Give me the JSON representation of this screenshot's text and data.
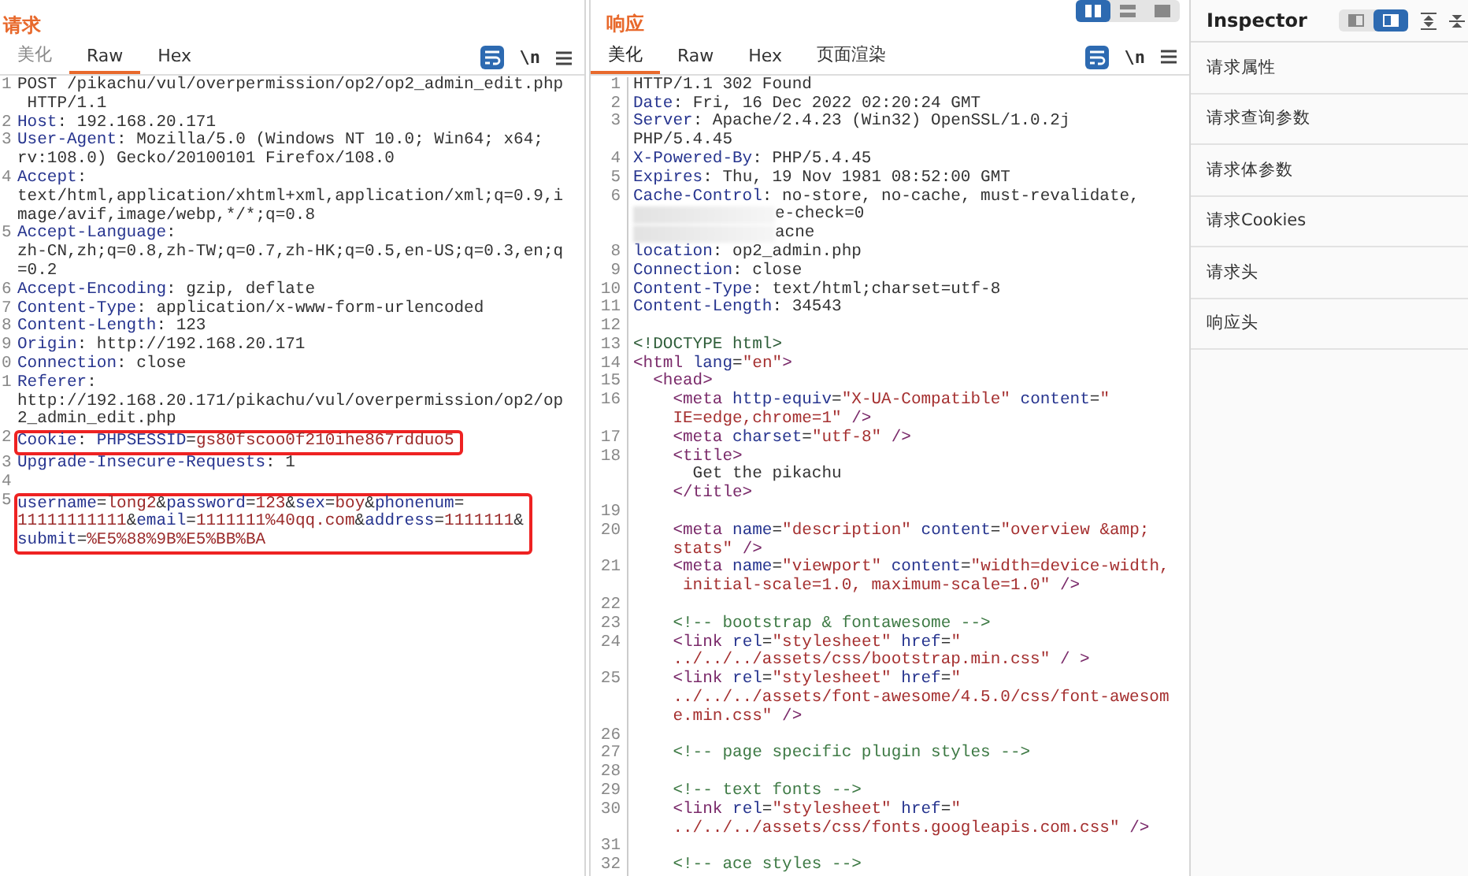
{
  "request": {
    "title": "请求",
    "tabs": [
      {
        "label": "美化",
        "selected": false
      },
      {
        "label": "Raw",
        "selected": true
      },
      {
        "label": "Hex",
        "selected": false
      }
    ],
    "newline_toggle": "\\n",
    "lines": [
      {
        "num": "1",
        "boxed": false,
        "rows": [
          {
            "parts": [
              {
                "kind": "plain",
                "text": "POST /pikachu/vul/overpermission/op2/op2_admin_edit.php"
              }
            ]
          },
          {
            "parts": [
              {
                "kind": "plain",
                "text": " HTTP/1.1"
              }
            ]
          }
        ]
      },
      {
        "num": "2",
        "boxed": false,
        "rows": [
          {
            "parts": [
              {
                "kind": "key",
                "text": "Host"
              },
              {
                "kind": "plain",
                "text": ": 192.168.20.171"
              }
            ]
          }
        ]
      },
      {
        "num": "3",
        "boxed": false,
        "rows": [
          {
            "parts": [
              {
                "kind": "key",
                "text": "User-Agent"
              },
              {
                "kind": "plain",
                "text": ": Mozilla/5.0 (Windows NT 10.0; Win64; x64;"
              }
            ]
          },
          {
            "parts": [
              {
                "kind": "plain",
                "text": "rv:108.0) Gecko/20100101 Firefox/108.0"
              }
            ]
          }
        ]
      },
      {
        "num": "4",
        "boxed": false,
        "rows": [
          {
            "parts": [
              {
                "kind": "key",
                "text": "Accept"
              },
              {
                "kind": "plain",
                "text": ":"
              }
            ]
          },
          {
            "parts": [
              {
                "kind": "plain",
                "text": "text/html,application/xhtml+xml,application/xml;q=0.9,i"
              }
            ]
          },
          {
            "parts": [
              {
                "kind": "plain",
                "text": "mage/avif,image/webp,*/*;q=0.8"
              }
            ]
          }
        ]
      },
      {
        "num": "5",
        "boxed": false,
        "rows": [
          {
            "parts": [
              {
                "kind": "key",
                "text": "Accept-Language"
              },
              {
                "kind": "plain",
                "text": ":"
              }
            ]
          },
          {
            "parts": [
              {
                "kind": "plain",
                "text": "zh-CN,zh;q=0.8,zh-TW;q=0.7,zh-HK;q=0.5,en-US;q=0.3,en;q"
              }
            ]
          },
          {
            "parts": [
              {
                "kind": "plain",
                "text": "=0.2"
              }
            ]
          }
        ]
      },
      {
        "num": "6",
        "boxed": false,
        "rows": [
          {
            "parts": [
              {
                "kind": "key",
                "text": "Accept-Encoding"
              },
              {
                "kind": "plain",
                "text": ": gzip, deflate"
              }
            ]
          }
        ]
      },
      {
        "num": "7",
        "boxed": false,
        "rows": [
          {
            "parts": [
              {
                "kind": "key",
                "text": "Content-Type"
              },
              {
                "kind": "plain",
                "text": ": application/x-www-form-urlencoded"
              }
            ]
          }
        ]
      },
      {
        "num": "8",
        "boxed": false,
        "rows": [
          {
            "parts": [
              {
                "kind": "key",
                "text": "Content-Length"
              },
              {
                "kind": "plain",
                "text": ": 123"
              }
            ]
          }
        ]
      },
      {
        "num": "9",
        "boxed": false,
        "rows": [
          {
            "parts": [
              {
                "kind": "key",
                "text": "Origin"
              },
              {
                "kind": "plain",
                "text": ": http://192.168.20.171"
              }
            ]
          }
        ]
      },
      {
        "num": "0",
        "boxed": false,
        "rows": [
          {
            "parts": [
              {
                "kind": "key",
                "text": "Connection"
              },
              {
                "kind": "plain",
                "text": ": close"
              }
            ]
          }
        ]
      },
      {
        "num": "1",
        "boxed": false,
        "rows": [
          {
            "parts": [
              {
                "kind": "key",
                "text": "Referer"
              },
              {
                "kind": "plain",
                "text": ":"
              }
            ]
          },
          {
            "parts": [
              {
                "kind": "plain",
                "text": "http://192.168.20.171/pikachu/vul/overpermission/op2/op"
              }
            ]
          },
          {
            "parts": [
              {
                "kind": "plain",
                "text": "2_admin_edit.php"
              }
            ]
          }
        ]
      },
      {
        "num": "2",
        "boxed": true,
        "rows": [
          {
            "parts": [
              {
                "kind": "key",
                "text": "Cookie"
              },
              {
                "kind": "plain",
                "text": ": "
              },
              {
                "kind": "pname",
                "text": "PHPSESSID"
              },
              {
                "kind": "plain",
                "text": "="
              },
              {
                "kind": "pval",
                "text": "gs80fscoo0f210ihe867rdduo5"
              }
            ]
          }
        ]
      },
      {
        "num": "3",
        "boxed": false,
        "rows": [
          {
            "parts": [
              {
                "kind": "key",
                "text": "Upgrade-Insecure-Requests"
              },
              {
                "kind": "plain",
                "text": ": 1"
              }
            ]
          }
        ]
      },
      {
        "num": "4",
        "boxed": false
      },
      {
        "num": "5",
        "boxed": true,
        "rows": [
          {
            "parts": [
              {
                "kind": "pname",
                "text": "username"
              },
              {
                "kind": "plain",
                "text": "="
              },
              {
                "kind": "pval",
                "text": "long2"
              },
              {
                "kind": "plain",
                "text": "&"
              },
              {
                "kind": "pname",
                "text": "password"
              },
              {
                "kind": "plain",
                "text": "="
              },
              {
                "kind": "pval",
                "text": "123"
              },
              {
                "kind": "plain",
                "text": "&"
              },
              {
                "kind": "pname",
                "text": "sex"
              },
              {
                "kind": "plain",
                "text": "="
              },
              {
                "kind": "pval",
                "text": "boy"
              },
              {
                "kind": "plain",
                "text": "&"
              },
              {
                "kind": "pname",
                "text": "phonenum"
              },
              {
                "kind": "plain",
                "text": "="
              }
            ]
          },
          {
            "parts": [
              {
                "kind": "pval",
                "text": "11111111111"
              },
              {
                "kind": "plain",
                "text": "&"
              },
              {
                "kind": "pname",
                "text": "email"
              },
              {
                "kind": "plain",
                "text": "="
              },
              {
                "kind": "pval",
                "text": "1111111%40qq.com"
              },
              {
                "kind": "plain",
                "text": "&"
              },
              {
                "kind": "pname",
                "text": "address"
              },
              {
                "kind": "plain",
                "text": "="
              },
              {
                "kind": "pval",
                "text": "1111111"
              },
              {
                "kind": "plain",
                "text": "&"
              }
            ]
          },
          {
            "parts": [
              {
                "kind": "pname",
                "text": "submit"
              },
              {
                "kind": "plain",
                "text": "="
              },
              {
                "kind": "pval",
                "text": "%E5%88%9B%E5%BB%BA"
              }
            ]
          }
        ]
      }
    ]
  },
  "response": {
    "title": "响应",
    "layout_buttons": [
      {
        "selected": true
      },
      {
        "selected": false
      },
      {
        "selected": false
      }
    ],
    "tabs": [
      {
        "label": "美化",
        "selected": true
      },
      {
        "label": "Raw",
        "selected": false
      },
      {
        "label": "Hex",
        "selected": false
      },
      {
        "label": "页面渲染",
        "selected": false
      }
    ],
    "newline_toggle": "\\n",
    "lines": [
      {
        "num": "1",
        "rows": [
          {
            "parts": [
              {
                "kind": "plain",
                "text": "HTTP/1.1 302 Found"
              }
            ]
          }
        ]
      },
      {
        "num": "2",
        "rows": [
          {
            "parts": [
              {
                "kind": "key",
                "text": "Date"
              },
              {
                "kind": "plain",
                "text": ": Fri, 16 Dec 2022 02:20:24 GMT"
              }
            ]
          }
        ]
      },
      {
        "num": "3",
        "rows": [
          {
            "parts": [
              {
                "kind": "key",
                "text": "Server"
              },
              {
                "kind": "plain",
                "text": ": Apache/2.4.23 (Win32) OpenSSL/1.0.2j"
              }
            ]
          },
          {
            "parts": [
              {
                "kind": "plain",
                "text": "PHP/5.4.45"
              }
            ]
          }
        ]
      },
      {
        "num": "4",
        "rows": [
          {
            "parts": [
              {
                "kind": "key",
                "text": "X-Powered-By"
              },
              {
                "kind": "plain",
                "text": ": PHP/5.4.45"
              }
            ]
          }
        ]
      },
      {
        "num": "5",
        "rows": [
          {
            "parts": [
              {
                "kind": "key",
                "text": "Expires"
              },
              {
                "kind": "plain",
                "text": ": Thu, 19 Nov 1981 08:52:00 GMT"
              }
            ]
          }
        ]
      },
      {
        "num": "6",
        "rows": [
          {
            "parts": [
              {
                "kind": "key",
                "text": "Cache-Control"
              },
              {
                "kind": "plain",
                "text": ": no-store, no-cache, must-revalidate,"
              }
            ]
          },
          {
            "parts": [
              {
                "kind": "smear"
              },
              {
                "kind": "plain",
                "text": "e-check=0"
              }
            ]
          }
        ]
      },
      {
        "rows": [
          {
            "parts": [
              {
                "kind": "smear"
              },
              {
                "kind": "plain",
                "text": "acne"
              }
            ]
          }
        ]
      },
      {
        "num": "8",
        "rows": [
          {
            "parts": [
              {
                "kind": "key",
                "text": "location"
              },
              {
                "kind": "plain",
                "text": ": op2_admin.php"
              }
            ]
          }
        ]
      },
      {
        "num": "9",
        "rows": [
          {
            "parts": [
              {
                "kind": "key",
                "text": "Connection"
              },
              {
                "kind": "plain",
                "text": ": close"
              }
            ]
          }
        ]
      },
      {
        "num": "10",
        "rows": [
          {
            "parts": [
              {
                "kind": "key",
                "text": "Content-Type"
              },
              {
                "kind": "plain",
                "text": ": text/html;charset=utf-8"
              }
            ]
          }
        ]
      },
      {
        "num": "11",
        "rows": [
          {
            "parts": [
              {
                "kind": "key",
                "text": "Content-Length"
              },
              {
                "kind": "plain",
                "text": ": 34543"
              }
            ]
          }
        ]
      },
      {
        "num": "12"
      },
      {
        "num": "13",
        "rows": [
          {
            "parts": [
              {
                "kind": "doctype",
                "text": "<!DOCTYPE html>"
              }
            ]
          }
        ]
      },
      {
        "num": "14",
        "rows": [
          {
            "parts": [
              {
                "kind": "tag",
                "text": "<html "
              },
              {
                "kind": "attr",
                "text": "lang"
              },
              {
                "kind": "plain",
                "text": "="
              },
              {
                "kind": "string",
                "text": "\"en\""
              },
              {
                "kind": "tag",
                "text": ">"
              }
            ]
          }
        ]
      },
      {
        "num": "15",
        "rows": [
          {
            "parts": [
              {
                "kind": "tag",
                "text": "  <head>"
              }
            ]
          }
        ]
      },
      {
        "num": "16",
        "rows": [
          {
            "parts": [
              {
                "kind": "tag",
                "text": "    <meta "
              },
              {
                "kind": "attr",
                "text": "http-equiv"
              },
              {
                "kind": "plain",
                "text": "="
              },
              {
                "kind": "string",
                "text": "\"X-UA-Compatible\" "
              },
              {
                "kind": "attr",
                "text": "content"
              },
              {
                "kind": "plain",
                "text": "="
              },
              {
                "kind": "string",
                "text": "\""
              }
            ]
          },
          {
            "parts": [
              {
                "kind": "string",
                "text": "    IE=edge,chrome=1\" "
              },
              {
                "kind": "tag",
                "text": "/>"
              }
            ]
          }
        ]
      },
      {
        "num": "17",
        "rows": [
          {
            "parts": [
              {
                "kind": "tag",
                "text": "    <meta "
              },
              {
                "kind": "attr",
                "text": "charset"
              },
              {
                "kind": "plain",
                "text": "="
              },
              {
                "kind": "string",
                "text": "\"utf-8\" "
              },
              {
                "kind": "tag",
                "text": "/>"
              }
            ]
          }
        ]
      },
      {
        "num": "18",
        "rows": [
          {
            "parts": [
              {
                "kind": "tag",
                "text": "    <title>"
              }
            ]
          },
          {
            "parts": [
              {
                "kind": "plain",
                "text": "      Get the pikachu"
              }
            ]
          },
          {
            "parts": [
              {
                "kind": "tag",
                "text": "    </title>"
              }
            ]
          }
        ]
      },
      {
        "num": "19"
      },
      {
        "num": "20",
        "rows": [
          {
            "parts": [
              {
                "kind": "tag",
                "text": "    <meta "
              },
              {
                "kind": "attr",
                "text": "name"
              },
              {
                "kind": "plain",
                "text": "="
              },
              {
                "kind": "string",
                "text": "\"description\" "
              },
              {
                "kind": "attr",
                "text": "content"
              },
              {
                "kind": "plain",
                "text": "="
              },
              {
                "kind": "string",
                "text": "\"overview &amp;"
              }
            ]
          },
          {
            "parts": [
              {
                "kind": "string",
                "text": "    stats\" "
              },
              {
                "kind": "tag",
                "text": "/>"
              }
            ]
          }
        ]
      },
      {
        "num": "21",
        "rows": [
          {
            "parts": [
              {
                "kind": "tag",
                "text": "    <meta "
              },
              {
                "kind": "attr",
                "text": "name"
              },
              {
                "kind": "plain",
                "text": "="
              },
              {
                "kind": "string",
                "text": "\"viewport\" "
              },
              {
                "kind": "attr",
                "text": "content"
              },
              {
                "kind": "plain",
                "text": "="
              },
              {
                "kind": "string",
                "text": "\"width=device-width,"
              }
            ]
          },
          {
            "parts": [
              {
                "kind": "string",
                "text": "     initial-scale=1.0, maximum-scale=1.0\" "
              },
              {
                "kind": "tag",
                "text": "/>"
              }
            ]
          }
        ]
      },
      {
        "num": "22"
      },
      {
        "num": "23",
        "rows": [
          {
            "parts": [
              {
                "kind": "comment",
                "text": "    <!-- bootstrap & fontawesome -->"
              }
            ]
          }
        ]
      },
      {
        "num": "24",
        "rows": [
          {
            "parts": [
              {
                "kind": "tag",
                "text": "    <link "
              },
              {
                "kind": "attr",
                "text": "rel"
              },
              {
                "kind": "plain",
                "text": "="
              },
              {
                "kind": "string",
                "text": "\"stylesheet\" "
              },
              {
                "kind": "attr",
                "text": "href"
              },
              {
                "kind": "plain",
                "text": "="
              },
              {
                "kind": "string",
                "text": "\""
              }
            ]
          },
          {
            "parts": [
              {
                "kind": "string",
                "text": "    ../../../assets/css/bootstrap.min.css\" "
              },
              {
                "kind": "tag",
                "text": "/ >"
              }
            ]
          }
        ]
      },
      {
        "num": "25",
        "rows": [
          {
            "parts": [
              {
                "kind": "tag",
                "text": "    <link "
              },
              {
                "kind": "attr",
                "text": "rel"
              },
              {
                "kind": "plain",
                "text": "="
              },
              {
                "kind": "string",
                "text": "\"stylesheet\" "
              },
              {
                "kind": "attr",
                "text": "href"
              },
              {
                "kind": "plain",
                "text": "="
              },
              {
                "kind": "string",
                "text": "\""
              }
            ]
          },
          {
            "parts": [
              {
                "kind": "string",
                "text": "    ../../../assets/font-awesome/4.5.0/css/font-awesom"
              }
            ]
          },
          {
            "parts": [
              {
                "kind": "string",
                "text": "    e.min.css\" "
              },
              {
                "kind": "tag",
                "text": "/>"
              }
            ]
          }
        ]
      },
      {
        "num": "26"
      },
      {
        "num": "27",
        "rows": [
          {
            "parts": [
              {
                "kind": "comment",
                "text": "    <!-- page specific plugin styles -->"
              }
            ]
          }
        ]
      },
      {
        "num": "28"
      },
      {
        "num": "29",
        "rows": [
          {
            "parts": [
              {
                "kind": "comment",
                "text": "    <!-- text fonts -->"
              }
            ]
          }
        ]
      },
      {
        "num": "30",
        "rows": [
          {
            "parts": [
              {
                "kind": "tag",
                "text": "    <link "
              },
              {
                "kind": "attr",
                "text": "rel"
              },
              {
                "kind": "plain",
                "text": "="
              },
              {
                "kind": "string",
                "text": "\"stylesheet\" "
              },
              {
                "kind": "attr",
                "text": "href"
              },
              {
                "kind": "plain",
                "text": "="
              },
              {
                "kind": "string",
                "text": "\""
              }
            ]
          },
          {
            "parts": [
              {
                "kind": "string",
                "text": "    ../../../assets/css/fonts.googleapis.com.css\" "
              },
              {
                "kind": "tag",
                "text": "/>"
              }
            ]
          }
        ]
      },
      {
        "num": "31"
      },
      {
        "num": "32",
        "rows": [
          {
            "parts": [
              {
                "kind": "comment",
                "text": "    <!-- ace styles -->"
              }
            ]
          }
        ]
      }
    ]
  },
  "inspector": {
    "title": "Inspector",
    "view_buttons": [
      {
        "selected": false
      },
      {
        "selected": true
      }
    ],
    "items": [
      "请求属性",
      "请求查询参数",
      "请求体参数",
      "请求Cookies",
      "请求头",
      "响应头"
    ]
  }
}
